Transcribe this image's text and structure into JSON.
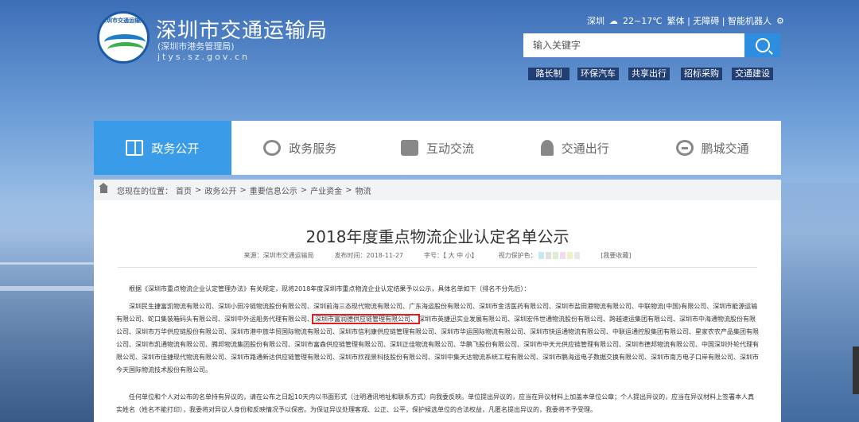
{
  "header": {
    "logo_text": "深圳市交通运输局",
    "title": "深圳市交通运输局",
    "subtitle": "(深圳市港务管理局)",
    "url": "jtys.sz.gov.cn",
    "city": "深圳",
    "weather": "22~17℃",
    "links": "繁体 | 无障碍 | 智能机器人",
    "search_placeholder": "输入关键字",
    "quick_links": [
      "路长制",
      "环保汽车",
      "共享出行",
      "招标采购",
      "交通建设"
    ]
  },
  "nav": {
    "items": [
      {
        "label": "政务公开",
        "icon": "book-icon",
        "active": true
      },
      {
        "label": "政务服务",
        "icon": "handshake-icon",
        "active": false
      },
      {
        "label": "互动交流",
        "icon": "chat-icon",
        "active": false
      },
      {
        "label": "交通出行",
        "icon": "traveler-icon",
        "active": false
      },
      {
        "label": "鹏城交通",
        "icon": "swirl-icon",
        "active": false
      }
    ]
  },
  "breadcrumb": {
    "prefix": "您现在的位置：",
    "items": [
      "首页",
      "政务公开",
      "重要信息公示",
      "产业资金",
      "物流"
    ],
    "sep": ">"
  },
  "article": {
    "title": "2018年度重点物流企业认定名单公示",
    "source": "来源：深圳市交通运输局",
    "time": "发布时间：2018-11-27",
    "font_size": "字号：【 大 中 小】",
    "vision": "视力保护色：",
    "favorite": "[我要收藏]",
    "swatch_colors": [
      "#c8e8f0",
      "#e0e0e0",
      "#d8f0d0",
      "#f8d8f0",
      "#f0f0c8",
      "#e8e8e8"
    ],
    "para1": "根据《深圳市重点物流企业认定管理办法》有关规定，现将2018年度深圳市重点物流企业认定结果予以公示，具体名单如下（排名不分先后）：",
    "para2_before": "深圳民生捷富凯物流有限公司、深圳小田冷链物流股份有限公司、深圳前海三态现代物流有限公司、广东海运股份有限公司、深圳市金活医药有限公司、深圳市盐田港物流有限公司、中联物流(中国)有限公司、深圳市能源运输有限公司、蛇口集装箱码头有限公司、深圳中外运船务代理有限公司、",
    "para2_highlight": "深圳市富润德供应链管理有限公司、",
    "para2_after": "深圳市英捷迅实业发展有限公司、深圳宏伟世通物流股份有限公司、跨越速运集团有限公司、深圳市中海通物流股份有限公司、深圳市万华供应链股份有限公司、深圳市港中旅华贸国际物流有限公司、深圳市信利康供应链管理有限公司、深圳市华运国际物流有限公司、深圳市快运通物流有限公司、中联运通控股集团有限公司、星家农农产品集团有限公司、深圳市凯通物流有限公司、腾邦物流集团股份有限公司、深圳市富森供应链管理有限公司、深圳正佳物流有限公司、华鹏飞股份有限公司、深圳市中天元供应链管理有限公司、深圳市德邦物流有限公司、中国深圳外轮代理有限公司、深圳市佳捷现代物流有限公司、深圳市路通新达供应链管理有限公司、深圳市欣视景科技股份有限公司、深圳中集天达物流系统工程有限公司、深圳市鹏海运电子数据交换有限公司、深圳市南方电子口岸有限公司、深圳市今天国际物流技术股份有限公司。",
    "para3": "任何单位和个人对公布的名单持有异议的，请在公布之日起10天内以书面形式（注明通讯地址和联系方式）向我委反映。单位提出异议的，应当在异议材料上加盖本单位公章；个人提出异议的，应当在异议材料上签署本人真实姓名（姓名不能打印），我委将对异议人身份和反映情况予以保密。为保证异议处理客观、公正、公平，保护候选单位的合法权益，凡匿名提出异议的，我委将不予受理。"
  }
}
